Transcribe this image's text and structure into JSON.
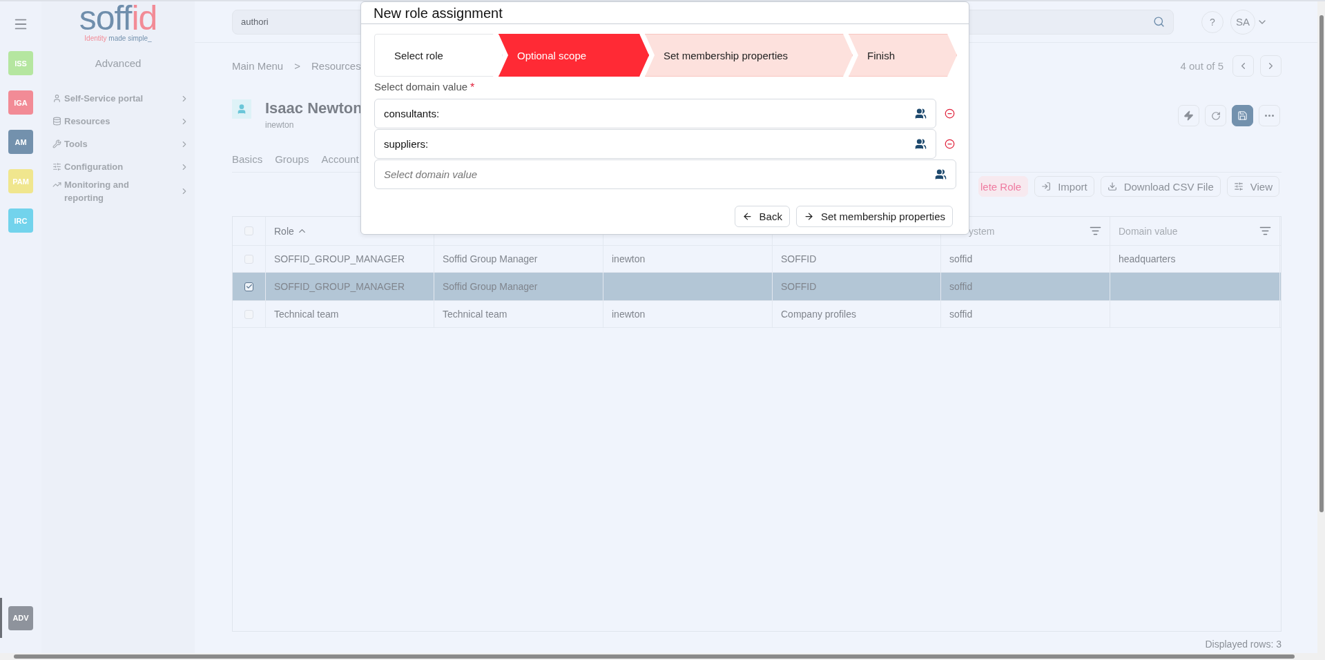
{
  "rail": {
    "items": [
      {
        "label": "ISS",
        "color": "#b5e6a0"
      },
      {
        "label": "IGA",
        "color": "#f28b96"
      },
      {
        "label": "AM",
        "color": "#7391ad"
      },
      {
        "label": "PAM",
        "color": "#f0e68e"
      },
      {
        "label": "IRC",
        "color": "#72d3ec"
      }
    ],
    "bottom_item": {
      "label": "ADV",
      "color": "#8e939c",
      "selected": true
    }
  },
  "logo": {
    "name_a": "soff",
    "name_b": "id",
    "tagline_a": "Identity",
    "tagline_b": " made simple_"
  },
  "sidebar": {
    "title": "Advanced",
    "items": [
      {
        "label": "Self-Service portal"
      },
      {
        "label": "Resources"
      },
      {
        "label": "Tools"
      },
      {
        "label": "Configuration"
      },
      {
        "label": "Monitoring and reporting"
      }
    ]
  },
  "header": {
    "search": {
      "value": "authori"
    },
    "help": "?",
    "avatar": "SA"
  },
  "breadcrumb": [
    "Main Menu",
    ">",
    "Resources"
  ],
  "pager": "4 out of 5",
  "user": {
    "name": "Isaac Newton",
    "login": "inewton"
  },
  "tabs": [
    {
      "label": "Basics"
    },
    {
      "label": "Groups"
    },
    {
      "label": "Account"
    }
  ],
  "toolbar": [
    {
      "kind": "danger",
      "label": "lete Role"
    },
    {
      "kind": "import",
      "label": "Import"
    },
    {
      "kind": "download",
      "label": "Download CSV File"
    },
    {
      "kind": "view",
      "label": "View"
    }
  ],
  "table": {
    "all_checked": false,
    "columns": [
      {
        "label": "Role",
        "sorted_ascending": true
      },
      {},
      {},
      {},
      {
        "label": "ystem",
        "filter": true
      },
      {
        "label": "Domain value",
        "filter": true
      }
    ],
    "rows": [
      {
        "checked": false,
        "selected": false,
        "cells": [
          "SOFFID_GROUP_MANAGER",
          "Soffid Group Manager",
          "inewton",
          "SOFFID",
          "soffid",
          "headquarters"
        ]
      },
      {
        "checked": true,
        "selected": true,
        "cells": [
          "SOFFID_GROUP_MANAGER",
          "Soffid Group Manager",
          null,
          "SOFFID",
          "soffid",
          null
        ]
      },
      {
        "checked": false,
        "selected": false,
        "cells": [
          "Technical team",
          "Technical team",
          "inewton",
          "Company profiles",
          "soffid",
          null
        ]
      }
    ],
    "footer": "Displayed rows: 3"
  },
  "dialog": {
    "title": "New role assignment",
    "steps": [
      {
        "label": "Select role",
        "done": true,
        "selected": false
      },
      {
        "label": "Optional scope",
        "done": false,
        "selected": true
      },
      {
        "label": "Set membership properties",
        "done": false,
        "selected": false
      },
      {
        "label": "Finish",
        "done": false,
        "selected": false
      }
    ],
    "field_label": "Select domain value",
    "required_mark": "*",
    "values": [
      {
        "value": "consultants:",
        "removable": true
      },
      {
        "value": "suppliers:",
        "removable": true
      },
      {
        "placeholder": "Select domain value"
      }
    ],
    "buttons": [
      {
        "kind": "back",
        "label": "Back"
      },
      {
        "kind": "next",
        "label": "Set membership properties"
      }
    ]
  }
}
